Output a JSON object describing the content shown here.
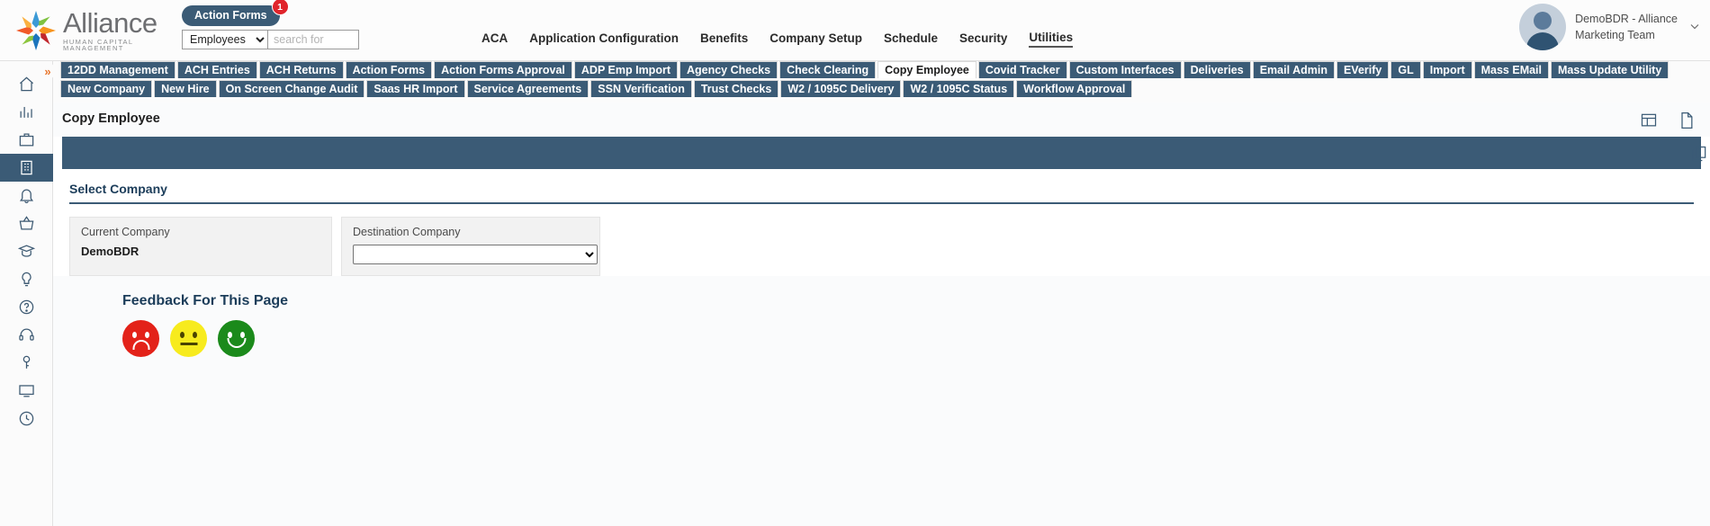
{
  "brand": {
    "name": "Alliance",
    "tagline": "HUMAN CAPITAL MANAGEMENT",
    "logo_icon": "alliance-starburst-logo"
  },
  "search": {
    "action_pill_label": "Action Forms",
    "action_pill_badge": "1",
    "scope_value": "Employees",
    "scope_options": [
      "Employees"
    ],
    "placeholder": "search for",
    "value": ""
  },
  "topnav": {
    "items": [
      {
        "label": "ACA",
        "active": false
      },
      {
        "label": "Application Configuration",
        "active": false
      },
      {
        "label": "Benefits",
        "active": false
      },
      {
        "label": "Company Setup",
        "active": false
      },
      {
        "label": "Schedule",
        "active": false
      },
      {
        "label": "Security",
        "active": false
      },
      {
        "label": "Utilities",
        "active": true
      }
    ]
  },
  "user": {
    "name_line1": "DemoBDR - Alliance",
    "name_line2": "Marketing Team",
    "chevron": "⌄"
  },
  "rail": {
    "expand_glyph": "»",
    "items": [
      {
        "name": "home-icon",
        "selected": false
      },
      {
        "name": "analytics-icon",
        "selected": false
      },
      {
        "name": "briefcase-icon",
        "selected": false
      },
      {
        "name": "building-icon",
        "selected": true
      },
      {
        "name": "bell-icon",
        "selected": false
      },
      {
        "name": "basket-icon",
        "selected": false
      },
      {
        "name": "graduation-cap-icon",
        "selected": false
      },
      {
        "name": "lightbulb-icon",
        "selected": false
      },
      {
        "name": "help-circle-icon",
        "selected": false
      },
      {
        "name": "headset-icon",
        "selected": false
      },
      {
        "name": "key-icon",
        "selected": false
      },
      {
        "name": "monitor-icon",
        "selected": false
      },
      {
        "name": "clock-icon",
        "selected": false
      }
    ]
  },
  "tabs": {
    "row1": [
      {
        "label": "12DD Management",
        "active": false
      },
      {
        "label": "ACH Entries",
        "active": false
      },
      {
        "label": "ACH Returns",
        "active": false
      },
      {
        "label": "Action Forms",
        "active": false
      },
      {
        "label": "Action Forms Approval",
        "active": false
      },
      {
        "label": "ADP Emp Import",
        "active": false
      },
      {
        "label": "Agency Checks",
        "active": false
      },
      {
        "label": "Check Clearing",
        "active": false
      },
      {
        "label": "Copy Employee",
        "active": true
      },
      {
        "label": "Covid Tracker",
        "active": false
      },
      {
        "label": "Custom Interfaces",
        "active": false
      },
      {
        "label": "Deliveries",
        "active": false
      },
      {
        "label": "Email Admin",
        "active": false
      },
      {
        "label": "EVerify",
        "active": false
      },
      {
        "label": "GL",
        "active": false
      },
      {
        "label": "Import",
        "active": false
      },
      {
        "label": "Mass EMail",
        "active": false
      },
      {
        "label": "Mass Update Utility",
        "active": false
      }
    ],
    "row2": [
      {
        "label": "New Company",
        "active": false
      },
      {
        "label": "New Hire",
        "active": false
      },
      {
        "label": "On Screen Change Audit",
        "active": false
      },
      {
        "label": "Saas HR Import",
        "active": false
      },
      {
        "label": "Service Agreements",
        "active": false
      },
      {
        "label": "SSN Verification",
        "active": false
      },
      {
        "label": "Trust Checks",
        "active": false
      },
      {
        "label": "W2 / 1095C Delivery",
        "active": false
      },
      {
        "label": "W2 / 1095C Status",
        "active": false
      },
      {
        "label": "Workflow Approval",
        "active": false
      }
    ]
  },
  "page": {
    "title": "Copy Employee",
    "toolbar_icons": [
      {
        "name": "grid-view-icon"
      },
      {
        "name": "document-icon"
      }
    ],
    "bluebar_icon": {
      "name": "copy-icon"
    }
  },
  "select_company": {
    "section_title": "Select Company",
    "current_company_label": "Current Company",
    "current_company_value": "DemoBDR",
    "destination_company_label": "Destination Company",
    "destination_company_value": "",
    "destination_company_options": [
      ""
    ]
  },
  "annotation": {
    "arrow_name": "red-arrow-pointing-to-destination-company",
    "color": "#f4362e"
  },
  "feedback": {
    "title": "Feedback For This Page",
    "faces": [
      {
        "name": "sad-face-button",
        "color": "#e32219"
      },
      {
        "name": "neutral-face-button",
        "color": "#f7eb1e"
      },
      {
        "name": "happy-face-button",
        "color": "#1b8a1b"
      }
    ]
  },
  "colors": {
    "primary": "#3b5b76",
    "accent_red": "#e0242b",
    "logo_gray": "#6d6e71"
  }
}
